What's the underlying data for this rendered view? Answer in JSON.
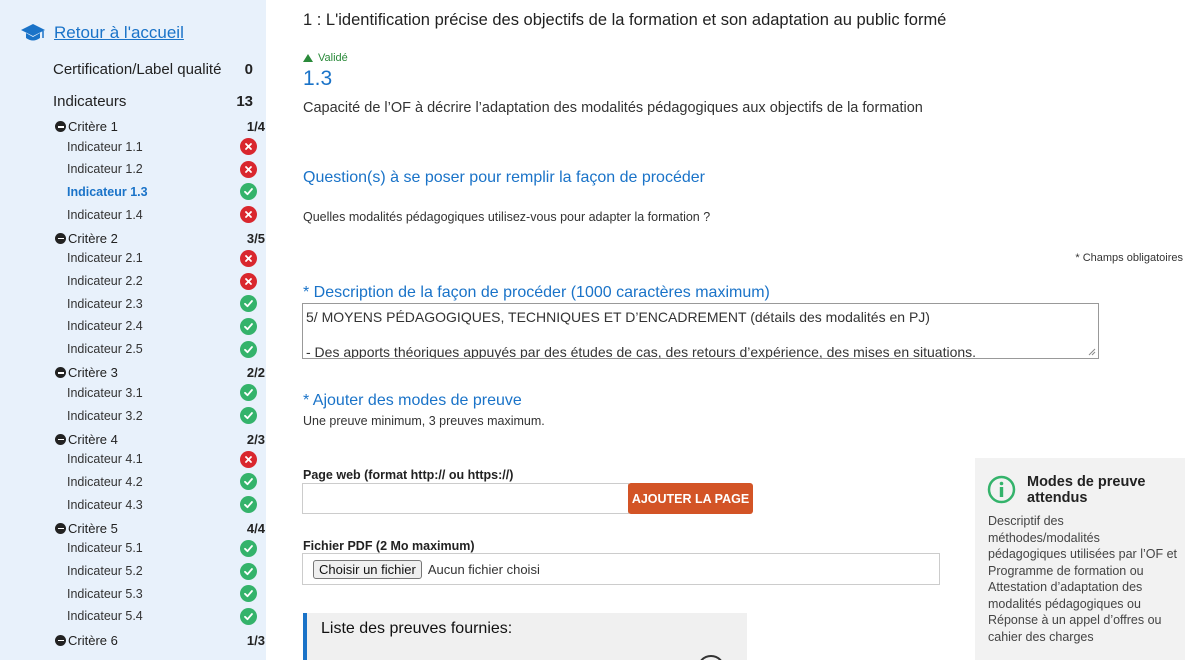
{
  "sidebar": {
    "home_label": "Retour à l'accueil",
    "certification": {
      "label": "Certification/Label qualité",
      "count": "0"
    },
    "indicateurs": {
      "label": "Indicateurs",
      "count": "13"
    },
    "criteres": [
      {
        "label": "Critère 1",
        "frac": "1/4",
        "items": [
          {
            "label": "Indicateur 1.1",
            "status": "ko"
          },
          {
            "label": "Indicateur 1.2",
            "status": "ko"
          },
          {
            "label": "Indicateur 1.3",
            "status": "ok",
            "active": true
          },
          {
            "label": "Indicateur 1.4",
            "status": "ko"
          }
        ]
      },
      {
        "label": "Critère 2",
        "frac": "3/5",
        "items": [
          {
            "label": "Indicateur 2.1",
            "status": "ko"
          },
          {
            "label": "Indicateur 2.2",
            "status": "ko"
          },
          {
            "label": "Indicateur 2.3",
            "status": "ok"
          },
          {
            "label": "Indicateur 2.4",
            "status": "ok"
          },
          {
            "label": "Indicateur 2.5",
            "status": "ok"
          }
        ]
      },
      {
        "label": "Critère 3",
        "frac": "2/2",
        "items": [
          {
            "label": "Indicateur 3.1",
            "status": "ok"
          },
          {
            "label": "Indicateur 3.2",
            "status": "ok"
          }
        ]
      },
      {
        "label": "Critère 4",
        "frac": "2/3",
        "items": [
          {
            "label": "Indicateur 4.1",
            "status": "ko"
          },
          {
            "label": "Indicateur 4.2",
            "status": "ok"
          },
          {
            "label": "Indicateur 4.3",
            "status": "ok"
          }
        ]
      },
      {
        "label": "Critère 5",
        "frac": "4/4",
        "items": [
          {
            "label": "Indicateur 5.1",
            "status": "ok"
          },
          {
            "label": "Indicateur 5.2",
            "status": "ok"
          },
          {
            "label": "Indicateur 5.3",
            "status": "ok"
          },
          {
            "label": "Indicateur 5.4",
            "status": "ok"
          }
        ]
      },
      {
        "label": "Critère 6",
        "frac": "1/3",
        "items": []
      }
    ]
  },
  "main": {
    "title": "1 : L'identification précise des objectifs de la formation et son adaptation au public formé",
    "status_label": "Validé",
    "indicator_number": "1.3",
    "indicator_description": "Capacité de l’OF à décrire l’adaptation des modalités pédagogiques aux objectifs de la formation",
    "questions_heading": "Question(s) à se poser pour remplir la façon de procéder",
    "question_text": "Quelles modalités pédagogiques utilisez-vous pour adapter la formation ?",
    "required_note": "* Champs obligatoires",
    "description_heading": "* Description de la façon de procéder (1000 caractères maximum)",
    "description_line1": "5/ MOYENS PÉDAGOGIQUES, TECHNIQUES ET D’ENCADREMENT (détails des modalités en PJ)",
    "description_line2": "- Des apports théoriques appuyés par des études de cas, des retours d’expérience, des mises en situations.",
    "proof_heading": "* Ajouter des modes de preuve",
    "proof_sub": "Une preuve minimum, 3 preuves maximum.",
    "web_label": "Page web (format http:// ou https://)",
    "web_value": "",
    "web_button": "AJOUTER LA PAGE",
    "pdf_label": "Fichier PDF (2 Mo maximum)",
    "file_button": "Choisir un fichier",
    "file_status": "Aucun fichier choisi",
    "proofs_list_title": "Liste des preuves fournies:"
  },
  "info_panel": {
    "title": "Modes de preuve attendus",
    "body": "Descriptif des méthodes/modalités pédagogiques utilisées par l’OF et Programme de formation ou Attestation d’adaptation des modalités pédagogiques ou Réponse à un appel d’offres ou cahier des charges"
  },
  "colors": {
    "accent": "#1a73c8",
    "ok": "#34b36b",
    "ko": "#d9272e",
    "button": "#d35426",
    "sidebar_bg": "#e8f1fb"
  }
}
